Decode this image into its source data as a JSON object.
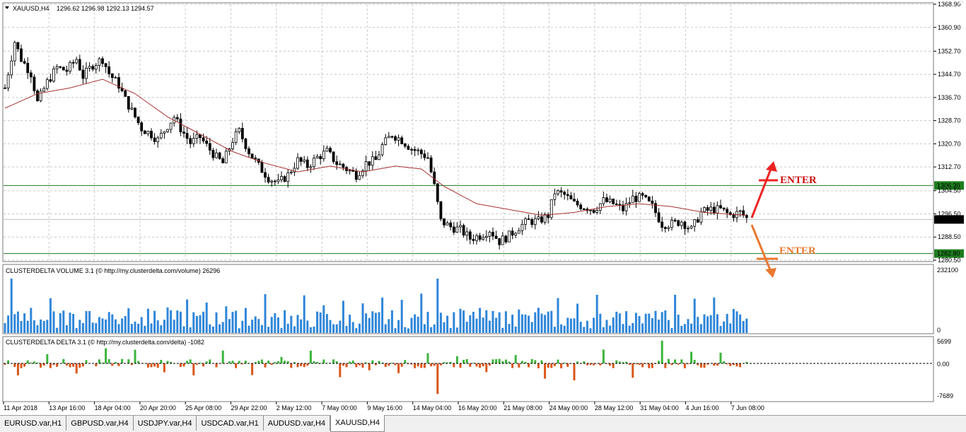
{
  "chart_data": {
    "type": "candlestick",
    "symbol_header": "XAUUSD,H4",
    "ohlc_header": "1296.62 1296.98 1292.13 1294.57",
    "y_ticks": [
      "1368.90",
      "1360.90",
      "1352.70",
      "1344.70",
      "1336.70",
      "1328.70",
      "1320.70",
      "1312.70",
      "1304.50",
      "1296.50",
      "1288.50",
      "1280.50"
    ],
    "ylim": [
      1280.5,
      1368.9
    ],
    "levels": [
      {
        "value": 1306.3,
        "label": "1306.30",
        "color": "#1e7d1e"
      },
      {
        "value": 1282.8,
        "label": "1282.80",
        "color": "#1e7d1e"
      }
    ],
    "current_price": {
      "value": 1294.57,
      "label": "1294.57"
    },
    "x_ticks": [
      "11 Apr 2018",
      "13 Apr 16:00",
      "18 Apr 04:00",
      "20 Apr 20:00",
      "25 Apr 08:00",
      "29 Apr 22:00",
      "2 May 12:00",
      "7 May 00:00",
      "9 May 16:00",
      "14 May 04:00",
      "16 May 20:00",
      "21 May 08:00",
      "24 May 00:00",
      "28 May 12:00",
      "31 May 04:00",
      "4 Jun 16:00",
      "7 Jun 08:00"
    ],
    "close_path": [
      [
        0,
        1340
      ],
      [
        3,
        1356
      ],
      [
        5,
        1350
      ],
      [
        8,
        1345
      ],
      [
        10,
        1335
      ],
      [
        13,
        1342
      ],
      [
        16,
        1347
      ],
      [
        19,
        1346
      ],
      [
        22,
        1350
      ],
      [
        24,
        1344
      ],
      [
        27,
        1348
      ],
      [
        30,
        1350
      ],
      [
        32,
        1345
      ],
      [
        35,
        1341
      ],
      [
        37,
        1336
      ],
      [
        40,
        1330
      ],
      [
        42,
        1326
      ],
      [
        45,
        1324
      ],
      [
        47,
        1322
      ],
      [
        50,
        1327
      ],
      [
        52,
        1330
      ],
      [
        54,
        1326
      ],
      [
        57,
        1321
      ],
      [
        60,
        1323
      ],
      [
        62,
        1320
      ],
      [
        65,
        1316
      ],
      [
        67,
        1314
      ],
      [
        70,
        1322
      ],
      [
        72,
        1325
      ],
      [
        75,
        1318
      ],
      [
        78,
        1313
      ],
      [
        81,
        1309
      ],
      [
        84,
        1307
      ],
      [
        87,
        1310
      ],
      [
        90,
        1315
      ],
      [
        93,
        1313
      ],
      [
        96,
        1316
      ],
      [
        99,
        1318
      ],
      [
        102,
        1314
      ],
      [
        105,
        1312
      ],
      [
        108,
        1310
      ],
      [
        111,
        1314
      ],
      [
        114,
        1315
      ],
      [
        116,
        1320
      ],
      [
        119,
        1324
      ],
      [
        122,
        1322
      ],
      [
        125,
        1319
      ],
      [
        127,
        1318
      ],
      [
        130,
        1316
      ],
      [
        132,
        1306
      ],
      [
        134,
        1294
      ],
      [
        137,
        1292
      ],
      [
        140,
        1291
      ],
      [
        143,
        1288
      ],
      [
        146,
        1289
      ],
      [
        149,
        1291
      ],
      [
        152,
        1287
      ],
      [
        155,
        1289
      ],
      [
        158,
        1292
      ],
      [
        161,
        1294
      ],
      [
        164,
        1294
      ],
      [
        167,
        1296
      ],
      [
        169,
        1304
      ],
      [
        172,
        1303
      ],
      [
        175,
        1300
      ],
      [
        178,
        1299
      ],
      [
        181,
        1298
      ],
      [
        184,
        1301
      ],
      [
        187,
        1300
      ],
      [
        190,
        1298
      ],
      [
        193,
        1302
      ],
      [
        196,
        1302
      ],
      [
        199,
        1299
      ],
      [
        202,
        1293
      ],
      [
        205,
        1293
      ],
      [
        208,
        1294
      ],
      [
        211,
        1291
      ],
      [
        214,
        1297
      ],
      [
        217,
        1298
      ],
      [
        220,
        1298
      ],
      [
        223,
        1296
      ],
      [
        226,
        1297
      ],
      [
        228,
        1295
      ]
    ],
    "ma_path": [
      [
        0,
        1333
      ],
      [
        10,
        1338
      ],
      [
        20,
        1340
      ],
      [
        30,
        1343
      ],
      [
        40,
        1338
      ],
      [
        50,
        1330
      ],
      [
        60,
        1324
      ],
      [
        70,
        1318
      ],
      [
        80,
        1314
      ],
      [
        90,
        1311
      ],
      [
        100,
        1313
      ],
      [
        110,
        1311
      ],
      [
        120,
        1313
      ],
      [
        128,
        1312
      ],
      [
        135,
        1306
      ],
      [
        145,
        1300
      ],
      [
        155,
        1298
      ],
      [
        165,
        1296
      ],
      [
        175,
        1297
      ],
      [
        185,
        1299
      ],
      [
        195,
        1300
      ],
      [
        205,
        1299
      ],
      [
        215,
        1297
      ],
      [
        228,
        1296
      ]
    ],
    "candle_count": 229,
    "volume_panel": {
      "title": "CLUSTERDELTA VOLUME 3.1 (© http://my.clusterdelta.com/volume) 26296",
      "y_ticks": [
        "232100",
        "0"
      ],
      "ylim": [
        0,
        232100
      ]
    },
    "delta_panel": {
      "title": "CLUSTERDELTA DELTA 3.1 (© http://my.clusterdelta.com/delta) -1082",
      "y_ticks": [
        "5699",
        "0.00",
        "-7689"
      ],
      "ylim": [
        -7689,
        5699
      ]
    },
    "annotations": [
      {
        "text": "ENTER",
        "color": "#cc1111"
      },
      {
        "text": "ENTER",
        "color": "#e87830"
      }
    ]
  },
  "tabs": [
    {
      "label": "EURUSD.var,H1",
      "active": false
    },
    {
      "label": "GBPUSD.var,H4",
      "active": false
    },
    {
      "label": "USDJPY.var,H4",
      "active": false
    },
    {
      "label": "USDCAD.var,H1",
      "active": false
    },
    {
      "label": "AUDUSD.var,H4",
      "active": false
    },
    {
      "label": "XAUUSD,H4",
      "active": true
    }
  ],
  "colors": {
    "bull_volume": "#2f86d8",
    "delta_pos": "#3cb43c",
    "delta_neg": "#d9561a",
    "ma": "#a83232",
    "grid": "#c8c8c8"
  }
}
